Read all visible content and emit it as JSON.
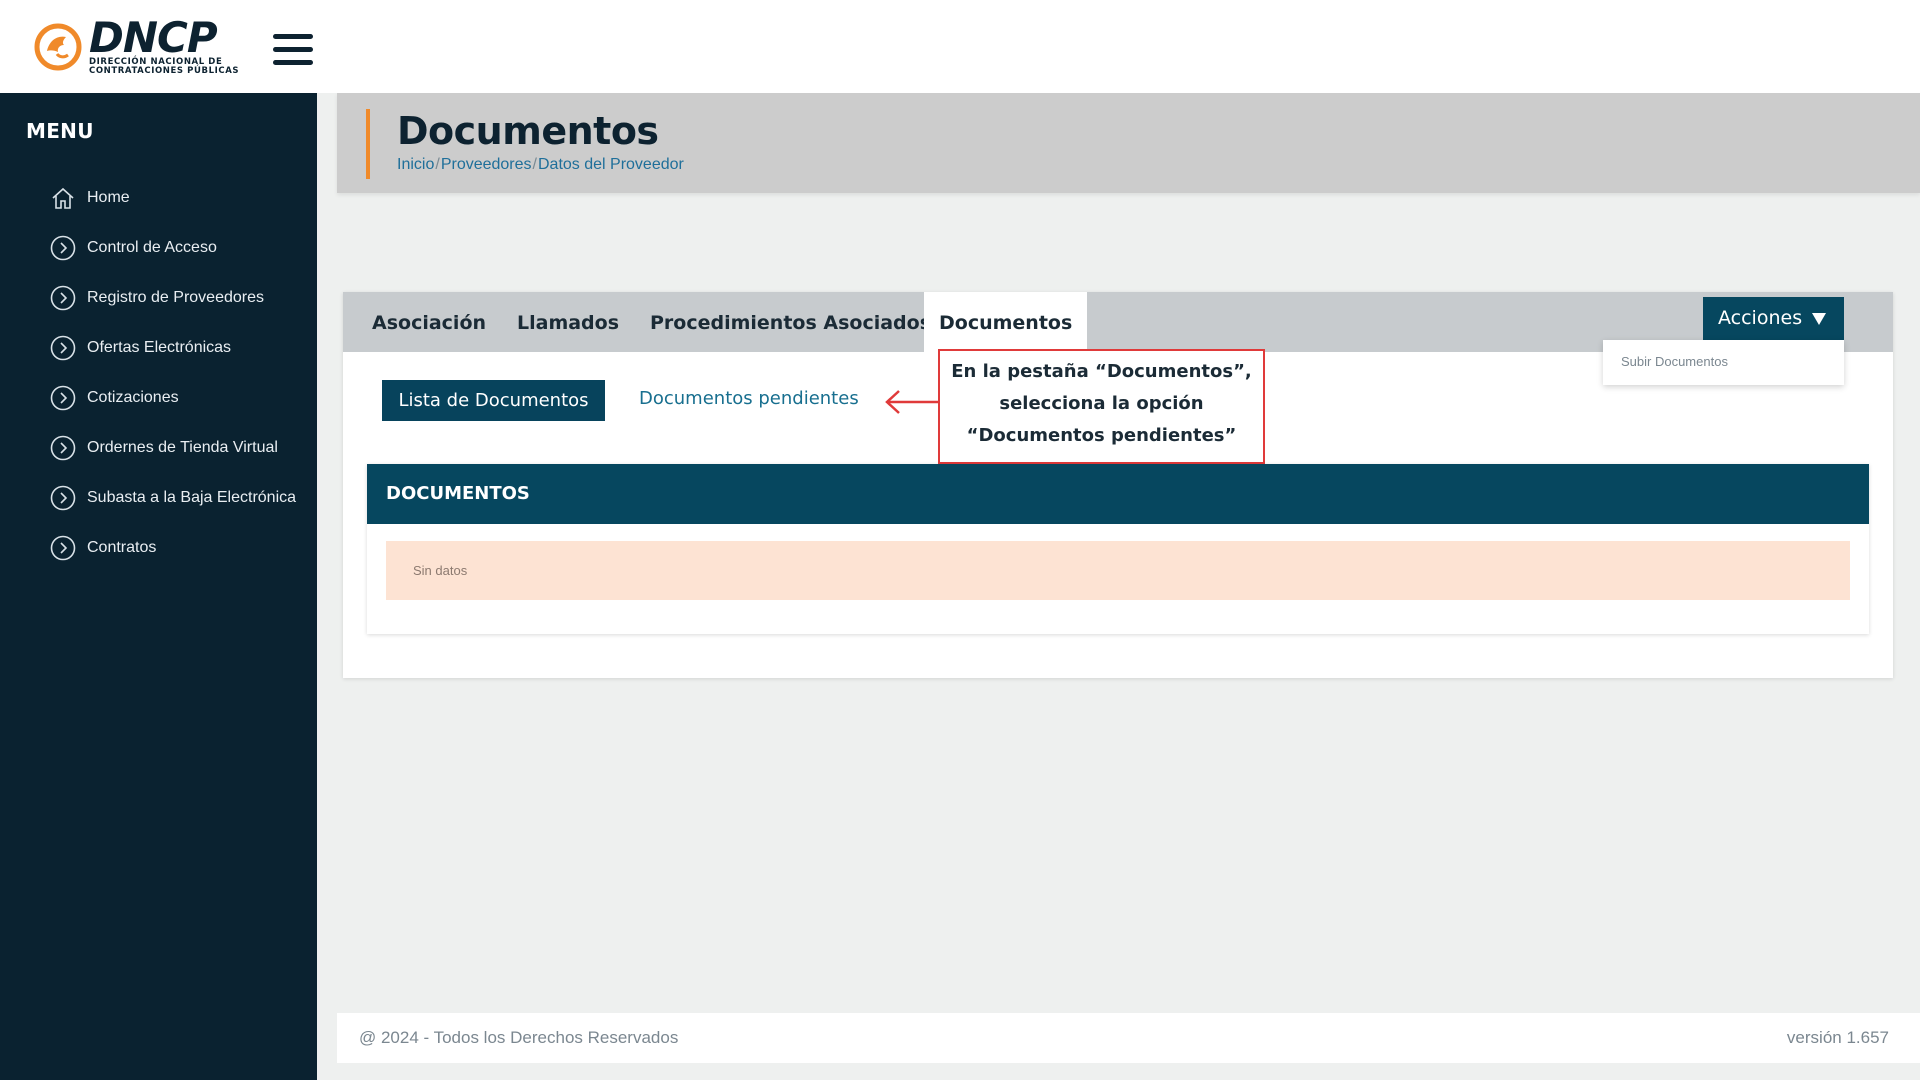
{
  "brand": {
    "title": "DNCP",
    "subtitle_line1": "DIRECCIÓN NACIONAL DE",
    "subtitle_line2": "CONTRATACIONES PÚBLICAS",
    "accent_color": "#f08a2a"
  },
  "sidebar": {
    "title": "MENU",
    "items": [
      {
        "label": "Home",
        "icon": "home-icon"
      },
      {
        "label": "Control de Acceso",
        "icon": "chevron-circle-icon"
      },
      {
        "label": "Registro de Proveedores",
        "icon": "chevron-circle-icon"
      },
      {
        "label": "Ofertas Electrónicas",
        "icon": "chevron-circle-icon"
      },
      {
        "label": "Cotizaciones",
        "icon": "chevron-circle-icon"
      },
      {
        "label": "Ordernes de Tienda Virtual",
        "icon": "chevron-circle-icon"
      },
      {
        "label": "Subasta a la Baja Electrónica",
        "icon": "chevron-circle-icon"
      },
      {
        "label": "Contratos",
        "icon": "chevron-circle-icon"
      }
    ]
  },
  "page": {
    "title": "Documentos",
    "breadcrumb": [
      "Inicio",
      "Proveedores",
      "Datos del Proveedor"
    ],
    "breadcrumb_separator": "/"
  },
  "tabs": [
    {
      "label": "Asociación",
      "active": false
    },
    {
      "label": "Llamados",
      "active": false
    },
    {
      "label": "Procedimientos Asociados",
      "active": false
    },
    {
      "label": "Documentos",
      "active": true
    }
  ],
  "actions": {
    "label": "Acciones",
    "menu": [
      "Subir Documentos"
    ]
  },
  "subnav": {
    "primary": "Lista de Documentos",
    "secondary": "Documentos pendientes"
  },
  "annotation": {
    "lines": [
      "En la pestaña “Documentos”,",
      "selecciona la opción",
      "“Documentos pendientes”"
    ],
    "color": "#e03a3a"
  },
  "documents": {
    "header": "DOCUMENTOS",
    "empty_text": "Sin datos"
  },
  "footer": {
    "copyright": "@ 2024 - Todos los Derechos Reservados",
    "version": "versión 1.657"
  }
}
